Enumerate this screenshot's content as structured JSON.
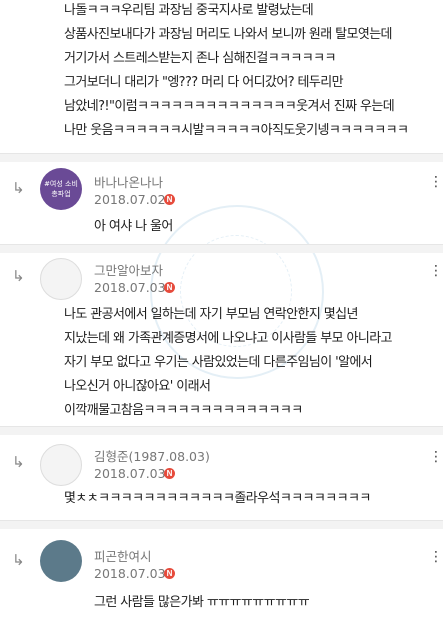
{
  "post": {
    "lines": [
      "나돌ㅋㅋㅋ우리팀 과장님 중국지사로 발령났는데",
      "상품사진보내다가 과장님 머리도 나와서 보니까 원래 탈모엿는데",
      "거기가서 스트레스받는지 존나 심해진걸ㅋㅋㅋㅋㅋㅋ",
      "그거보더니 대리가 \"엥??? 머리 다 어디갔어? 테두리만",
      "남았네?!\"이럼ㅋㅋㅋㅋㅋㅋㅋㅋㅋㅋㅋㅋㅋㅋ웃겨서 진짜 우는데",
      "나만 웃음ㅋㅋㅋㅋㅋㅋ시발ㅋㅋㅋㅋㅋ아직도웃기넹ㅋㅋㅋㅋㅋㅋㅋ"
    ]
  },
  "comments": [
    {
      "name": "바나나온나나",
      "date": "2018.07.02",
      "badge": "N",
      "avatar": "purple-badge-avatar",
      "avatar_text": "#여성 소비\n총파업",
      "lines": [
        "아 여샤 나 울어"
      ]
    },
    {
      "name": "그만알아보자",
      "date": "2018.07.03",
      "badge": "N",
      "avatar": "sketch-avatar",
      "lines": [
        "나도 관공서에서 일하는데 자기 부모님 연락안한지 몇십년",
        "지났는데 왜 가족관계증명서에 나오냐고 이사람들 부모 아니라고",
        "자기 부모 없다고 우기는 사람있었는데 다른주임님이 '알에서",
        "나오신거 아니잖아요' 이래서",
        "이깍깨물고참음ㅋㅋㅋㅋㅋㅋㅋㅋㅋㅋㅋㅋㅋㅋ"
      ]
    },
    {
      "name": "김형준(1987.08.03)",
      "date": "2018.07.03",
      "badge": "N",
      "avatar": "sketch-avatar",
      "lines": [
        "몇ㅊㅊㅋㅋㅋㅋㅋㅋㅋㅋㅋㅋㅋㅋ졸라우석ㅋㅋㅋㅋㅋㅋㅋㅋ"
      ]
    },
    {
      "name": "피곤한여시",
      "date": "2018.07.03",
      "badge": "N",
      "avatar": "photo-avatar",
      "lines": [
        "그런 사람들 많은가봐 ㅠㅠㅠㅠㅠㅠㅠㅠㅠ"
      ]
    }
  ],
  "icons": {
    "reply": "↳",
    "more": "⋮"
  }
}
